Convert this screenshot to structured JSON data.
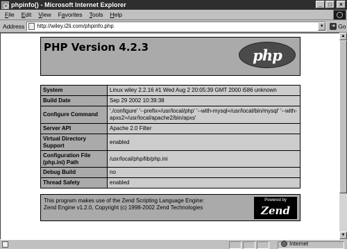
{
  "window": {
    "title": "phpinfo() - Microsoft Internet Explorer",
    "buttons": {
      "minimize": "_",
      "maximize": "□",
      "close": "×"
    }
  },
  "menu": [
    {
      "label": "File",
      "underline": "F",
      "rest": "ile"
    },
    {
      "label": "Edit",
      "underline": "E",
      "rest": "dit"
    },
    {
      "label": "View",
      "underline": "V",
      "rest": "iew"
    },
    {
      "label": "Favorites",
      "underline": "a",
      "pre": "F",
      "rest": "vorites"
    },
    {
      "label": "Tools",
      "underline": "T",
      "rest": "ools"
    },
    {
      "label": "Help",
      "underline": "H",
      "rest": "elp"
    }
  ],
  "address": {
    "label": "Address",
    "url": "http://wiley.i2li.com/phpinfo.php",
    "go_label": "Go"
  },
  "page": {
    "version_title": "PHP Version 4.2.3",
    "php_logo_text": "php",
    "rows": [
      {
        "key": "System",
        "value": "Linux wiley 2.2.16 #1 Wed Aug 2 20:05:39 GMT 2000 i586 unknown"
      },
      {
        "key": "Build Date",
        "value": "Sep 29 2002 10:39:38"
      },
      {
        "key": "Configure Command",
        "value": "'./configure' '--prefix=/usr/local/php' '--with-mysql=/usr/local/bin/mysql' '--with-apxs2=/usr/local/apache2/bin/apxs'"
      },
      {
        "key": "Server API",
        "value": "Apache 2.0 Filter"
      },
      {
        "key": "Virtual Directory Support",
        "value": "enabled"
      },
      {
        "key": "Configuration File (php.ini) Path",
        "value": "/usr/local/php/lib/php.ini"
      },
      {
        "key": "Debug Build",
        "value": "no"
      },
      {
        "key": "Thread Safety",
        "value": "enabled"
      }
    ],
    "footer_line1": "This program makes use of the Zend Scripting Language Engine:",
    "footer_line2": "Zend Engine v1.2.0, Copyright (c) 1998-2002 Zend Technologies",
    "zend_powered_by": "Powered by",
    "zend_word": "Zend"
  },
  "status": {
    "zone": "Internet"
  }
}
